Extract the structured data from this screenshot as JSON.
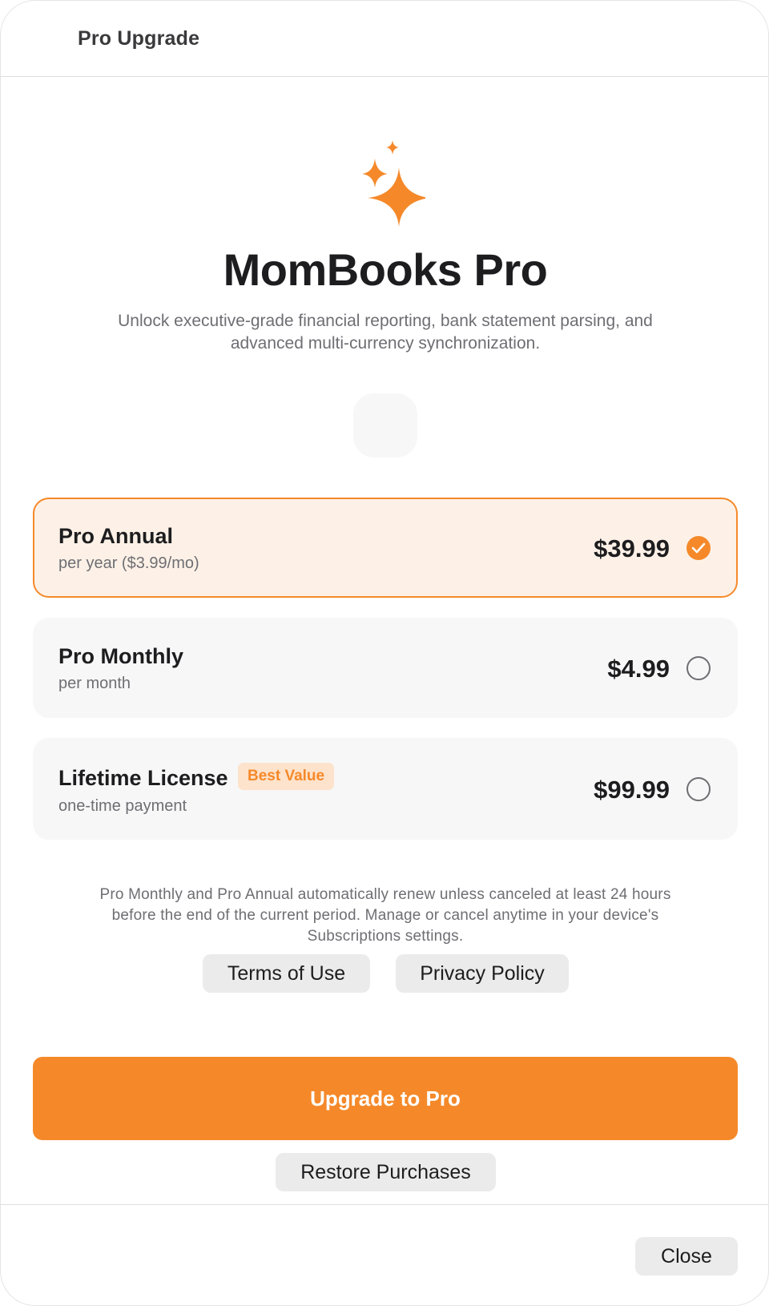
{
  "window": {
    "title": "Pro Upgrade"
  },
  "hero": {
    "icon": "sparkles-icon",
    "app_name": "MomBooks Pro",
    "subtitle_line1": "Unlock executive-grade financial reporting, bank statement parsing, and",
    "subtitle_line2": "advanced multi-currency synchronization."
  },
  "plans": [
    {
      "name": "Pro Annual",
      "detail": "per year ($3.99/mo)",
      "price": "$39.99",
      "selected": true
    },
    {
      "name": "Pro Monthly",
      "detail": "per month",
      "price": "$4.99",
      "selected": false
    },
    {
      "name": "Lifetime License",
      "detail": "one-time payment",
      "price": "$99.99",
      "selected": false,
      "badge": "Best Value"
    }
  ],
  "fineprint": {
    "line1": "Pro Monthly and Pro Annual automatically renew unless canceled at least 24 hours",
    "line2": "before the end of the current period. Manage or cancel anytime in your device's",
    "line3": "Subscriptions settings."
  },
  "links": {
    "terms": "Terms of Use",
    "privacy": "Privacy Policy"
  },
  "actions": {
    "upgrade": "Upgrade to Pro",
    "restore": "Restore Purchases",
    "close": "Close"
  },
  "colors": {
    "accent": "#f5892a",
    "selected_bg": "#fdf1e7",
    "card_bg": "#f7f7f7",
    "badge_bg": "#fde3cc"
  }
}
